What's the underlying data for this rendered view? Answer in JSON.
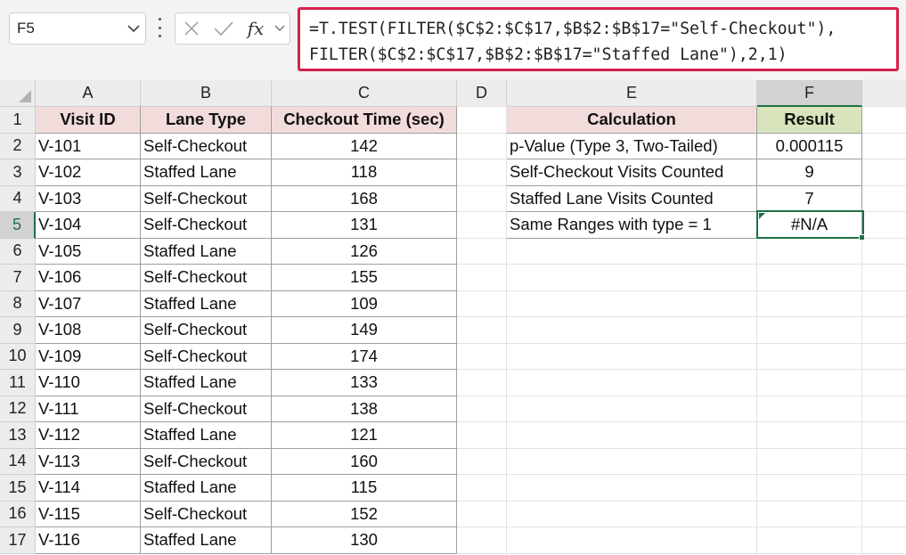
{
  "name_box": {
    "value": "F5"
  },
  "formula_bar": {
    "cancel_icon": "x-icon",
    "enter_icon": "check-icon",
    "function_label": "fx",
    "line1": "=T.TEST(FILTER($C$2:$C$17,$B$2:$B$17=\"Self-Checkout\"),",
    "line2": "FILTER($C$2:$C$17,$B$2:$B$17=\"Staffed Lane\"),2,1)"
  },
  "columns": [
    "A",
    "B",
    "C",
    "D",
    "E",
    "F"
  ],
  "rows": [
    "1",
    "2",
    "3",
    "4",
    "5",
    "6",
    "7",
    "8",
    "9",
    "10",
    "11",
    "12",
    "13",
    "14",
    "15",
    "16",
    "17"
  ],
  "table": {
    "headers": [
      "Visit ID",
      "Lane Type",
      "Checkout Time (sec)"
    ],
    "rows": [
      [
        "V-101",
        "Self-Checkout",
        "142"
      ],
      [
        "V-102",
        "Staffed Lane",
        "118"
      ],
      [
        "V-103",
        "Self-Checkout",
        "168"
      ],
      [
        "V-104",
        "Self-Checkout",
        "131"
      ],
      [
        "V-105",
        "Staffed Lane",
        "126"
      ],
      [
        "V-106",
        "Self-Checkout",
        "155"
      ],
      [
        "V-107",
        "Staffed Lane",
        "109"
      ],
      [
        "V-108",
        "Self-Checkout",
        "149"
      ],
      [
        "V-109",
        "Self-Checkout",
        "174"
      ],
      [
        "V-110",
        "Staffed Lane",
        "133"
      ],
      [
        "V-111",
        "Self-Checkout",
        "138"
      ],
      [
        "V-112",
        "Staffed Lane",
        "121"
      ],
      [
        "V-113",
        "Self-Checkout",
        "160"
      ],
      [
        "V-114",
        "Staffed Lane",
        "115"
      ],
      [
        "V-115",
        "Self-Checkout",
        "152"
      ],
      [
        "V-116",
        "Staffed Lane",
        "130"
      ]
    ]
  },
  "calc": {
    "headers": [
      "Calculation",
      "Result"
    ],
    "rows": [
      [
        "p-Value (Type 3, Two-Tailed)",
        "0.000115"
      ],
      [
        "Self-Checkout Visits Counted",
        "9"
      ],
      [
        "Staffed Lane Visits Counted",
        "7"
      ],
      [
        "Same Ranges with type = 1",
        "#N/A"
      ]
    ]
  },
  "colors": {
    "formula_highlight": "#d4204a",
    "header_fill": "#f2dcdb",
    "result_header_fill": "#d8e4bc",
    "selection": "#1e7145"
  }
}
